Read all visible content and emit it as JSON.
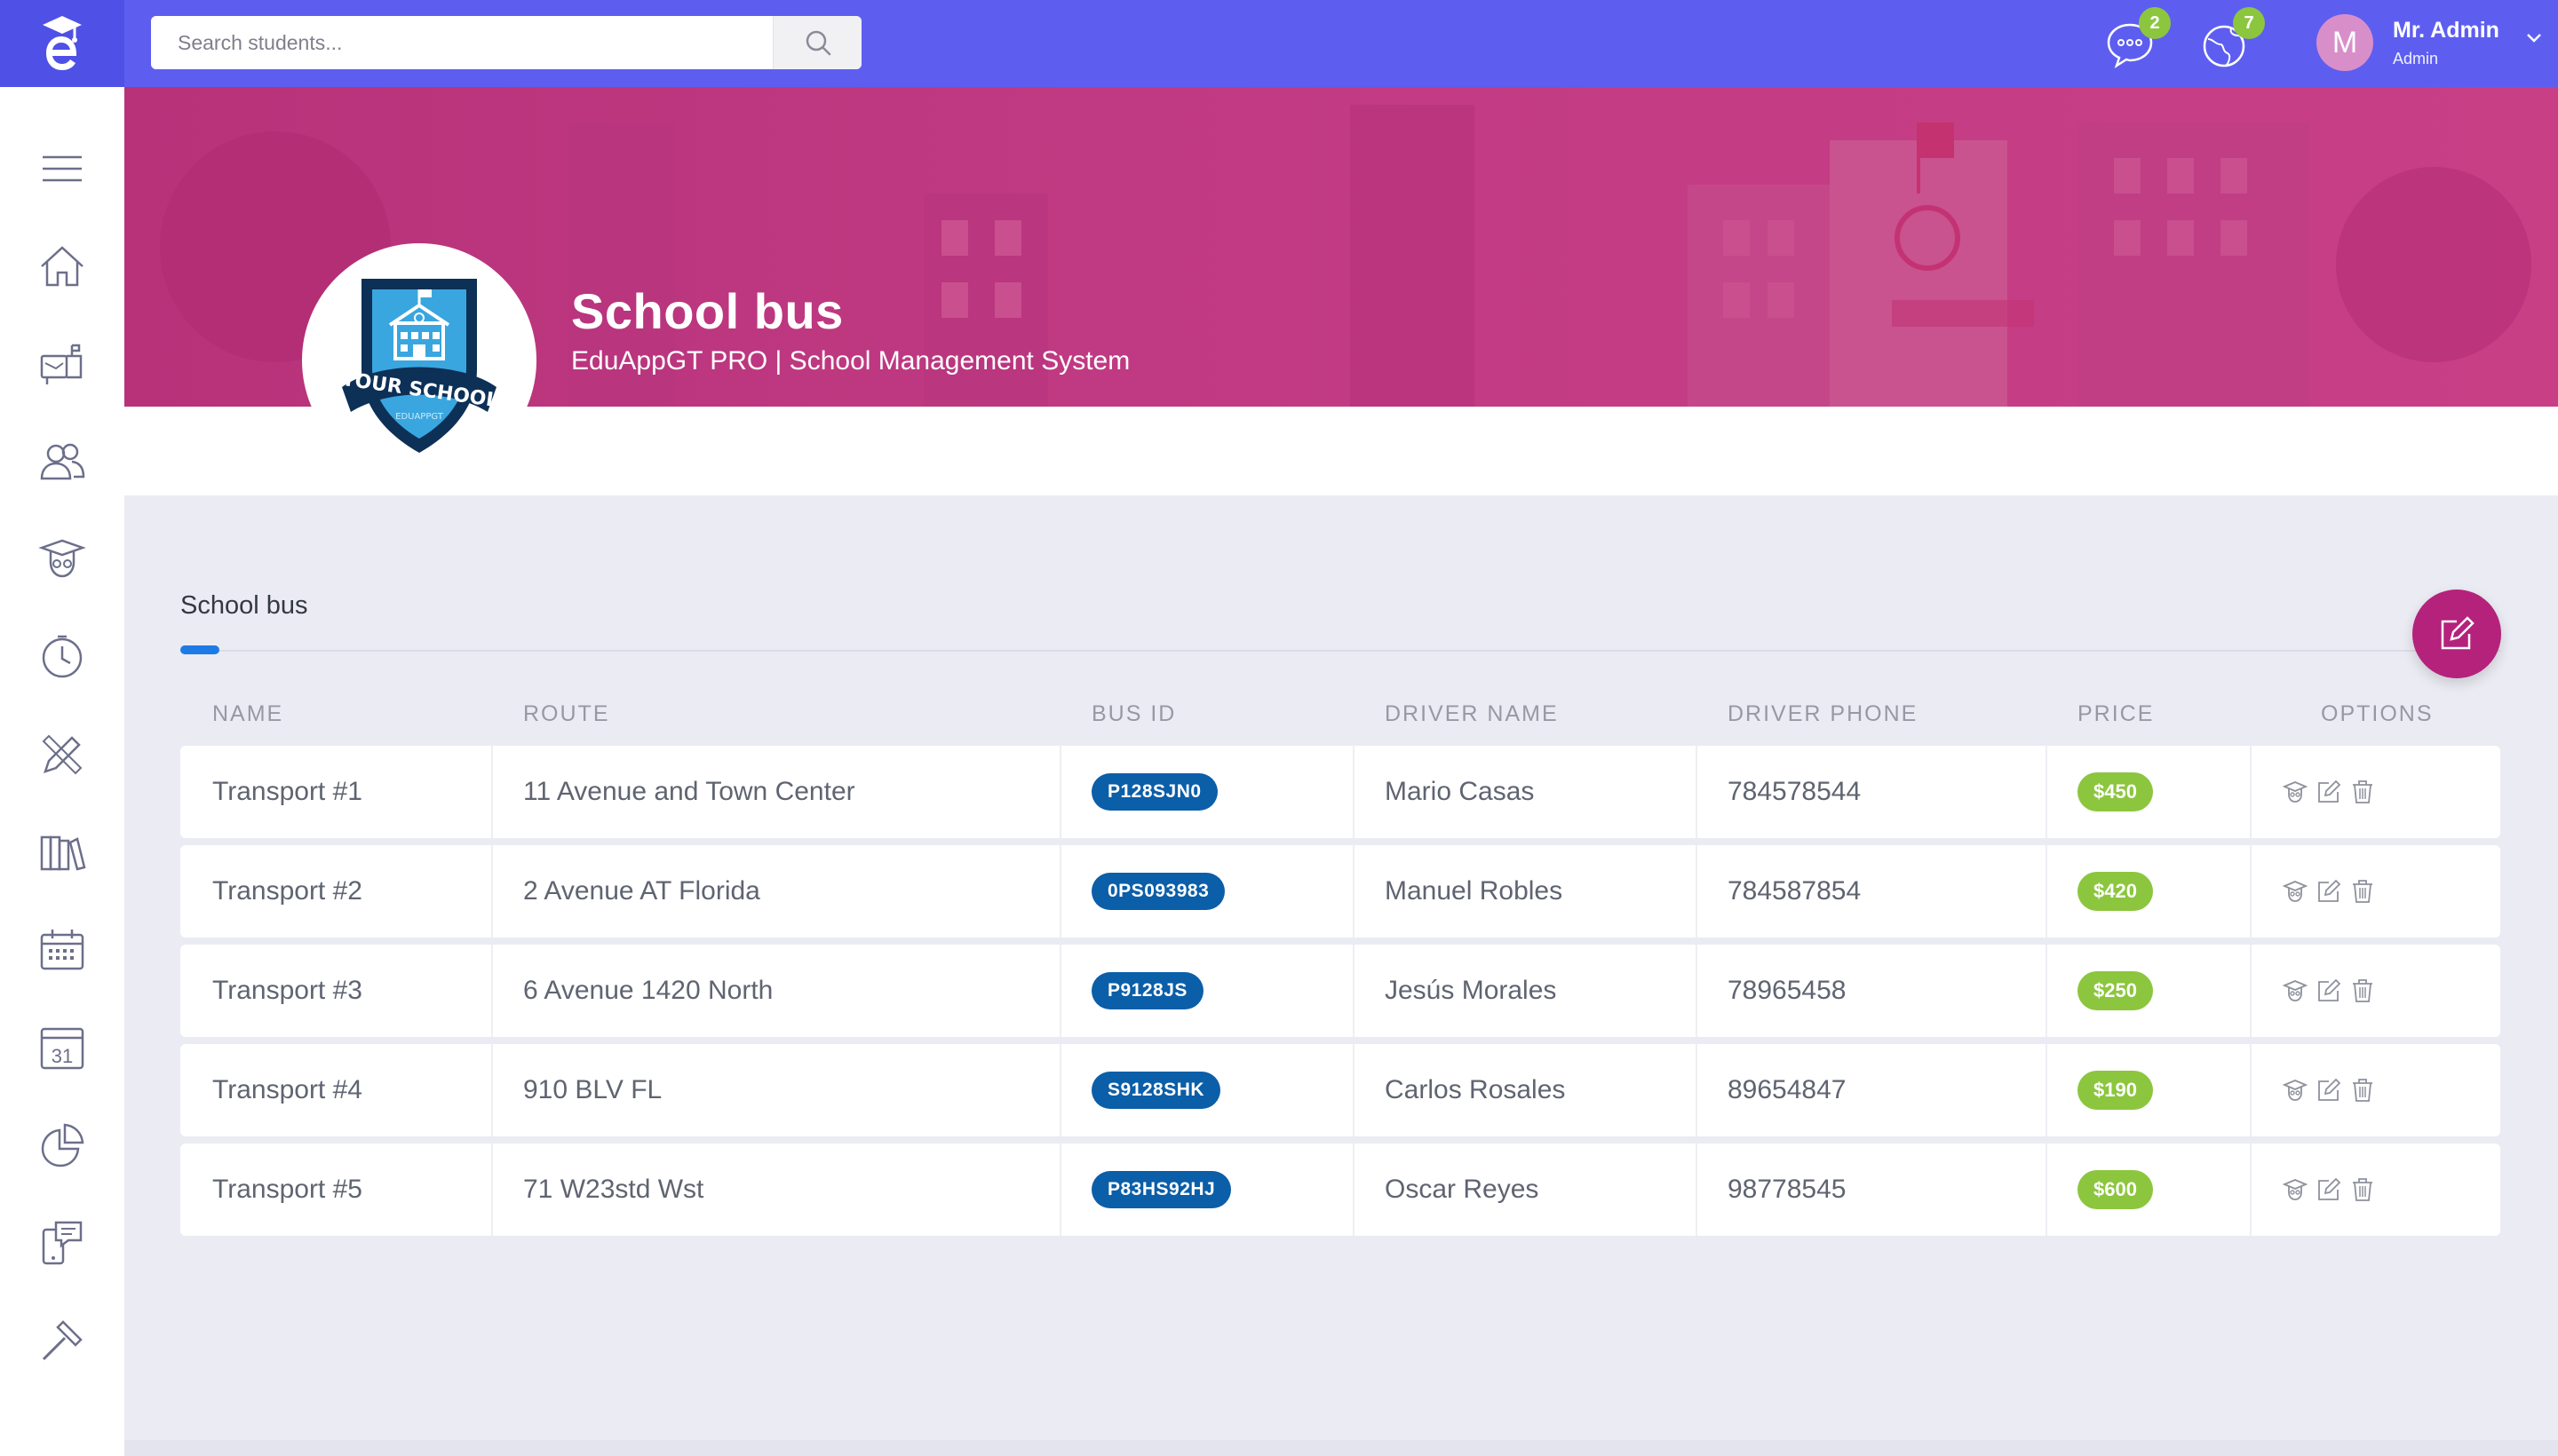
{
  "topbar": {
    "search_placeholder": "Search students...",
    "messages_badge": "2",
    "notifications_badge": "7",
    "user_initial": "M",
    "user_name": "Mr. Admin",
    "user_role": "Admin"
  },
  "sidebar": {
    "items": [
      "menu-icon",
      "home-icon",
      "mailbox-icon",
      "users-icon",
      "graduate-icon",
      "clock-icon",
      "pencil-ruler-icon",
      "books-icon",
      "calendar-icon",
      "calendar-31-icon",
      "pie-chart-icon",
      "mobile-message-icon",
      "hammer-icon"
    ],
    "calendar_day": "31"
  },
  "banner": {
    "title": "School bus",
    "subtitle": "EduAppGT PRO | School Management System",
    "logo_text": "YOUR SCHOOL",
    "logo_subtext": "EDUAPPGT"
  },
  "section": {
    "title": "School bus"
  },
  "table": {
    "headers": {
      "name": "NAME",
      "route": "ROUTE",
      "bus_id": "BUS ID",
      "driver_name": "DRIVER NAME",
      "driver_phone": "DRIVER PHONE",
      "price": "PRICE",
      "options": "OPTIONS"
    },
    "rows": [
      {
        "name": "Transport #1",
        "route": "11 Avenue and Town Center",
        "bus_id": "P128SJN0",
        "driver": "Mario Casas",
        "phone": "784578544",
        "price": "$450"
      },
      {
        "name": "Transport #2",
        "route": "2 Avenue AT Florida",
        "bus_id": "0PS093983",
        "driver": "Manuel Robles",
        "phone": "784587854",
        "price": "$420"
      },
      {
        "name": "Transport #3",
        "route": "6 Avenue 1420 North",
        "bus_id": "P9128JS",
        "driver": "Jesús Morales",
        "phone": "78965458",
        "price": "$250"
      },
      {
        "name": "Transport #4",
        "route": "910 BLV FL",
        "bus_id": "S9128SHK",
        "driver": "Carlos Rosales",
        "phone": "89654847",
        "price": "$190"
      },
      {
        "name": "Transport #5",
        "route": "71 W23std Wst",
        "bus_id": "P83HS92HJ",
        "driver": "Oscar Reyes",
        "phone": "98778545",
        "price": "$600"
      }
    ]
  },
  "colors": {
    "topbar": "#5d5ef0",
    "banner": "#c03a83",
    "fab": "#b4227c",
    "bus_id_badge": "#0b5ea8",
    "price_badge": "#8cc63e",
    "accent": "#1e7be6"
  }
}
